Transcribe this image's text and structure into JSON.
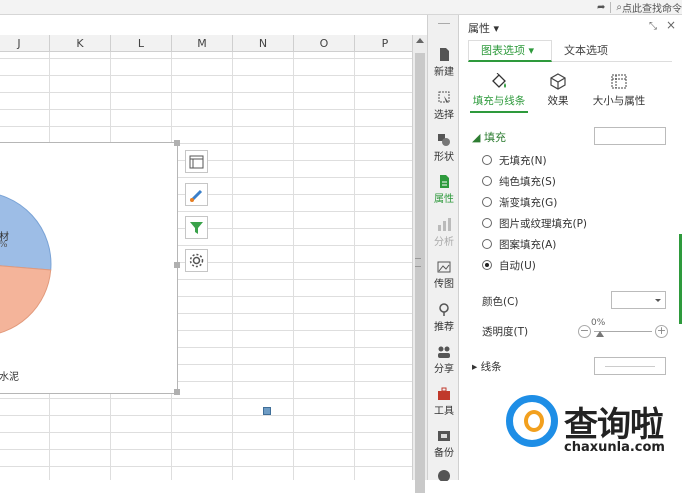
{
  "topbar": {
    "search_hint": "点此查找命令"
  },
  "sheet": {
    "columns": [
      "J",
      "K",
      "L",
      "M",
      "N",
      "O",
      "P"
    ]
  },
  "chart": {
    "labels": {
      "slice1_name": "材",
      "slice1_pct": "%",
      "slice2_name": "水泥"
    },
    "tools": [
      "chart-elements-icon",
      "chart-style-brush-icon",
      "chart-filter-icon",
      "chart-settings-icon"
    ]
  },
  "chart_data": {
    "type": "pie",
    "categories": [
      "材",
      "水泥"
    ],
    "colors": [
      "#9dbde6",
      "#f4b49a"
    ]
  },
  "dock": {
    "items": [
      {
        "label": "新建",
        "icon": "new-doc-icon"
      },
      {
        "label": "选择",
        "icon": "select-icon"
      },
      {
        "label": "形状",
        "icon": "shapes-icon"
      },
      {
        "label": "属性",
        "icon": "properties-icon"
      },
      {
        "label": "分析",
        "icon": "analysis-icon"
      },
      {
        "label": "传图",
        "icon": "upload-image-icon"
      },
      {
        "label": "推荐",
        "icon": "recommend-icon"
      },
      {
        "label": "分享",
        "icon": "share-icon"
      },
      {
        "label": "工具",
        "icon": "toolbox-icon"
      },
      {
        "label": "备份",
        "icon": "backup-icon"
      }
    ]
  },
  "panel": {
    "title": "属性 ▾",
    "tabs": {
      "chart": "图表选项 ▾",
      "text": "文本选项"
    },
    "subtabs": {
      "fill": "填充与线条",
      "effect": "效果",
      "size": "大小与属性"
    },
    "fill": {
      "heading": "填充",
      "options": [
        "无填充(N)",
        "纯色填充(S)",
        "渐变填充(G)",
        "图片或纹理填充(P)",
        "图案填充(A)",
        "自动(U)"
      ],
      "selected_index": 5
    },
    "color_label": "颜色(C)",
    "transparency_label": "透明度(T)",
    "transparency_value": "0%",
    "line_heading": "线条"
  },
  "watermark": {
    "title": "查询啦",
    "url": "chaxunla.com"
  }
}
